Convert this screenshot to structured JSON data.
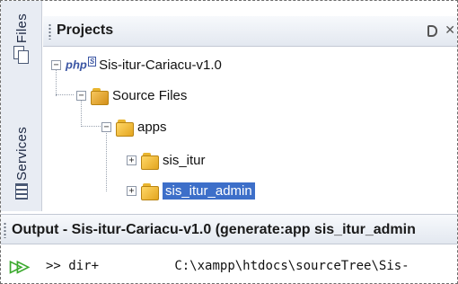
{
  "sidebar": {
    "files_label": "Files",
    "services_label": "Services"
  },
  "projects_panel": {
    "title": "Projects",
    "icons": [
      "minimize-icon",
      "close-icon"
    ]
  },
  "tree": {
    "root": {
      "label": "Sis-itur-Cariacu-v1.0",
      "icon": "php-project-icon",
      "php_mark": "php"
    },
    "source_files": {
      "label": "Source Files"
    },
    "apps": {
      "label": "apps"
    },
    "sis_itur": {
      "label": "sis_itur"
    },
    "sis_itur_admin": {
      "label": "sis_itur_admin",
      "selected": true
    }
  },
  "output": {
    "title": "Output - Sis-itur-Cariacu-v1.0 (generate:app sis_itur_admin",
    "prompt": ">> dir+",
    "path": "C:\\xampp\\htdocs\\sourceTree\\Sis-"
  },
  "colors": {
    "selection": "#3d6fc9",
    "folder": "#e9b52f",
    "rerun": "#3caa2f"
  }
}
